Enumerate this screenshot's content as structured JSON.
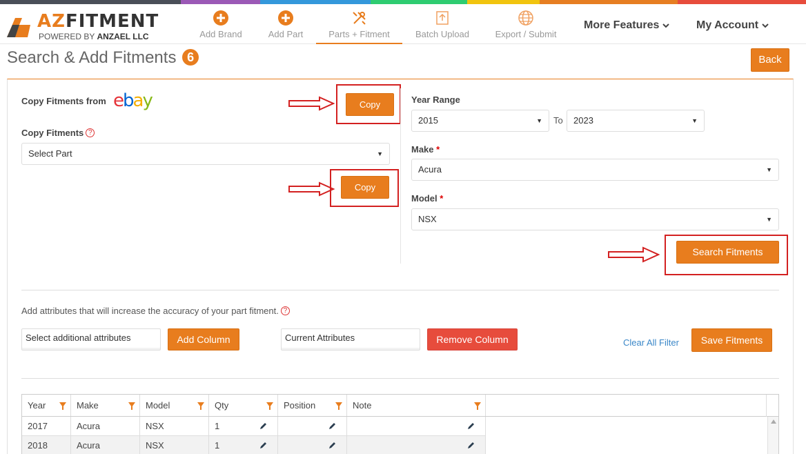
{
  "colors": {
    "accent": "#e87d1e",
    "danger": "#e74c3c",
    "link": "#3a87c8",
    "annotation": "#d32020",
    "strip": [
      "#4a4f58",
      "#9b59b6",
      "#3498db",
      "#2ecc71",
      "#f1c40f",
      "#e67e22",
      "#e74c3c"
    ]
  },
  "logo": {
    "brand_az": "AZ",
    "brand_rest": "FITMENT",
    "tagline_prefix": "POWERED BY ",
    "tagline_company": "ANZAEL LLC"
  },
  "nav": {
    "items": [
      {
        "label": "Add Brand",
        "icon": "plus-circle-icon"
      },
      {
        "label": "Add Part",
        "icon": "plus-circle-icon"
      },
      {
        "label": "Parts + Fitment",
        "icon": "tools-icon",
        "active": true
      },
      {
        "label": "Batch Upload",
        "icon": "upload-icon"
      },
      {
        "label": "Export / Submit",
        "icon": "globe-icon"
      }
    ],
    "more_features": "More Features",
    "my_account": "My Account"
  },
  "page": {
    "title": "Search & Add Fitments",
    "badge": "6",
    "back_label": "Back"
  },
  "copy_section": {
    "copy_from_label": "Copy Fitments from",
    "ebay_letters": [
      "e",
      "b",
      "a",
      "y"
    ],
    "copy_button_1": "Copy",
    "copy_fitments_label": "Copy Fitments",
    "help_glyph": "?",
    "select_part_value": "Select Part",
    "copy_button_2": "Copy"
  },
  "search_section": {
    "year_range_label": "Year Range",
    "year_from": "2015",
    "to_label": "To",
    "year_to": "2023",
    "make_label": "Make",
    "make_value": "Acura",
    "model_label": "Model",
    "model_value": "NSX",
    "required_mark": "*",
    "search_button": "Search Fitments"
  },
  "attributes": {
    "description": "Add attributes that will increase the accuracy of your part fitment.",
    "select_placeholder": "Select additional attributes",
    "add_column": "Add Column",
    "current_attributes": "Current Attributes",
    "remove_column": "Remove Column",
    "clear_filter": "Clear All Filter",
    "save_fitments": "Save Fitments"
  },
  "grid": {
    "columns": [
      "Year",
      "Make",
      "Model",
      "Qty",
      "Position",
      "Note"
    ],
    "rows": [
      {
        "year": "2017",
        "make": "Acura",
        "model": "NSX",
        "qty": "1",
        "position": "",
        "note": ""
      },
      {
        "year": "2018",
        "make": "Acura",
        "model": "NSX",
        "qty": "1",
        "position": "",
        "note": ""
      }
    ]
  }
}
